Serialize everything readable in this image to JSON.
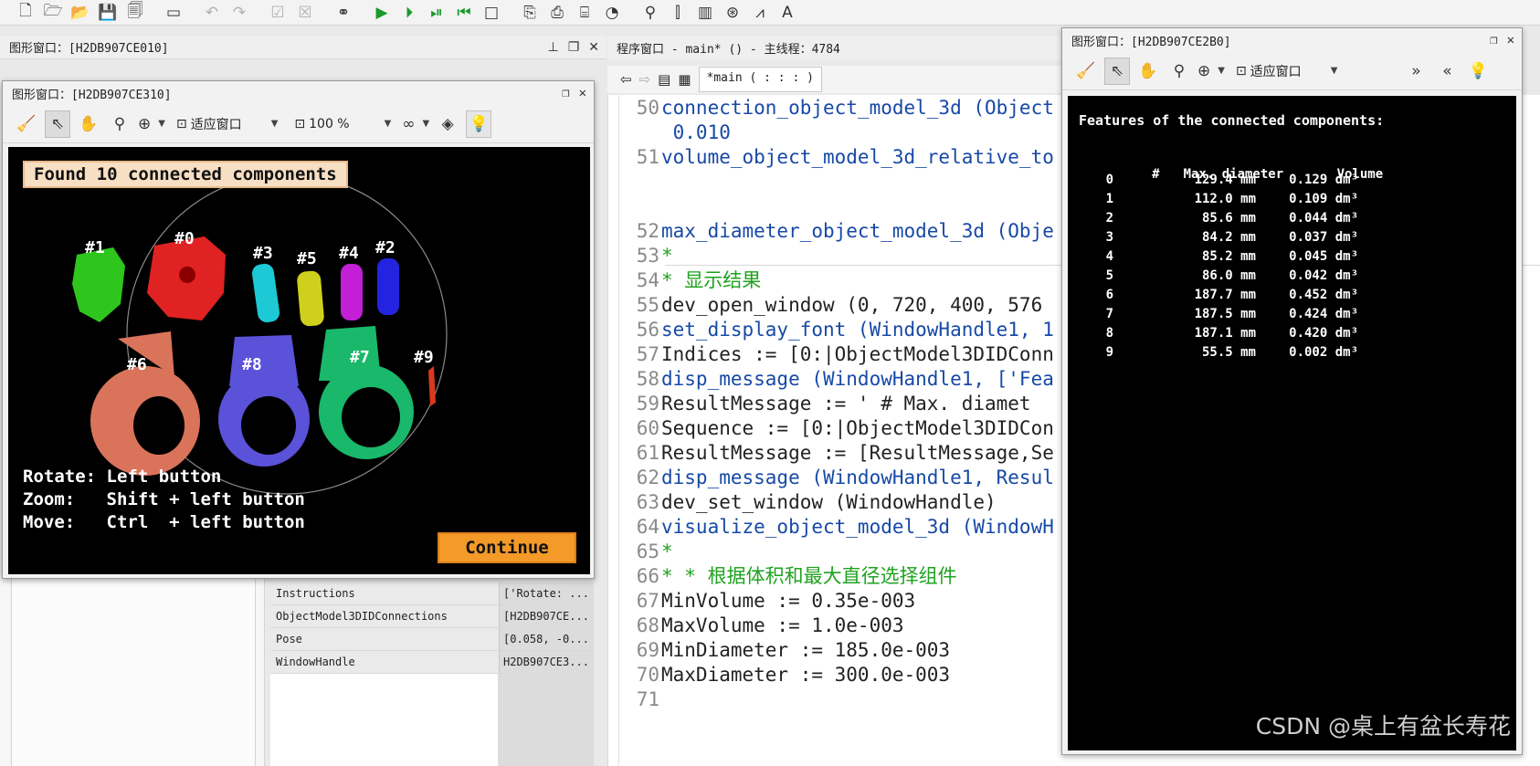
{
  "toolbar": {
    "icons": [
      "new-file-icon",
      "open-file-icon",
      "open-example-icon",
      "save-icon",
      "save-all-icon",
      "record-icon",
      "undo-icon",
      "redo-icon",
      "check-icon",
      "clear-check-icon",
      "find-icon",
      "run-icon",
      "step-over-icon",
      "step-into-icon",
      "step-out-icon",
      "stop-icon",
      "insert-icon",
      "export-icon",
      "assistant-icon",
      "profiler-icon",
      "zoom-icon",
      "histogram-icon",
      "bar-chart-icon",
      "ocr-icon",
      "line-profile-icon",
      "font-icon"
    ]
  },
  "bg_graphics_window": {
    "title": "图形窗口：[H2DB907CE010]"
  },
  "program_window": {
    "title": "程序窗口 - main* () - 主线程：4784",
    "tab_label": "*main ( : : : )",
    "lines": [
      {
        "n": "50",
        "text": "connection_object_model_3d (Object",
        "kind": "op"
      },
      {
        "n": "",
        "text": "                         0.010",
        "kind": "op"
      },
      {
        "n": "51",
        "text": "volume_object_model_3d_relative_to",
        "kind": "op"
      },
      {
        "n": "52",
        "text": "max_diameter_object_model_3d (Obje",
        "kind": "op"
      },
      {
        "n": "53",
        "text": "*",
        "kind": "cm"
      },
      {
        "n": "54",
        "text": "* 显示结果",
        "kind": "cm"
      },
      {
        "n": "55",
        "text": "dev_open_window (0, 720, 400, 576",
        "kind": "as"
      },
      {
        "n": "56",
        "text": "set_display_font (WindowHandle1, 1",
        "kind": "op"
      },
      {
        "n": "57",
        "text": "Indices := [0:|ObjectModel3DIDConn",
        "kind": "as"
      },
      {
        "n": "58",
        "text": "disp_message (WindowHandle1, ['Fea",
        "kind": "op"
      },
      {
        "n": "59",
        "text": "ResultMessage := '  #  Max. diamet",
        "kind": "as"
      },
      {
        "n": "60",
        "text": "Sequence := [0:|ObjectModel3DIDCon",
        "kind": "as"
      },
      {
        "n": "61",
        "text": "ResultMessage := [ResultMessage,Se",
        "kind": "as"
      },
      {
        "n": "62",
        "text": "disp_message (WindowHandle1, Resul",
        "kind": "op"
      },
      {
        "n": "63",
        "text": "dev_set_window (WindowHandle)",
        "kind": "as"
      },
      {
        "n": "64",
        "text": "visualize_object_model_3d (WindowH",
        "kind": "op"
      },
      {
        "n": "65",
        "text": "*",
        "kind": "cm"
      },
      {
        "n": "66",
        "text": "* * 根据体积和最大直径选择组件",
        "kind": "cm"
      },
      {
        "n": "67",
        "text": "MinVolume := 0.35e-003",
        "kind": "as"
      },
      {
        "n": "68",
        "text": "MaxVolume := 1.0e-003",
        "kind": "as"
      },
      {
        "n": "69",
        "text": "MinDiameter := 185.0e-003",
        "kind": "as"
      },
      {
        "n": "70",
        "text": "MaxDiameter := 300.0e-003",
        "kind": "as"
      },
      {
        "n": "71",
        "text": "",
        "kind": "as"
      }
    ]
  },
  "variables": [
    {
      "name": "Instructions",
      "value": "['Rotate: ..."
    },
    {
      "name": "ObjectModel3DIDConnections",
      "value": "[H2DB907CE..."
    },
    {
      "name": "Pose",
      "value": "[0.058, -0..."
    },
    {
      "name": "WindowHandle",
      "value": "H2DB907CE3..."
    }
  ],
  "gw310": {
    "title": "图形窗口：[H2DB907CE310]",
    "fit_label": "适应窗口",
    "zoom_label": "100 %",
    "found_text": "Found 10 connected components",
    "instructions": [
      "Rotate: Left button",
      "Zoom:   Shift + left button",
      "Move:   Ctrl  + left button"
    ],
    "continue_label": "Continue",
    "components": [
      {
        "label": "#0",
        "color": "#e02020"
      },
      {
        "label": "#1",
        "color": "#27c81f"
      },
      {
        "label": "#2",
        "color": "#2020e8"
      },
      {
        "label": "#3",
        "color": "#1ccfd6"
      },
      {
        "label": "#4",
        "color": "#c020d8"
      },
      {
        "label": "#5",
        "color": "#d8d81a"
      },
      {
        "label": "#6",
        "color": "#d9735a"
      },
      {
        "label": "#7",
        "color": "#19b86a"
      },
      {
        "label": "#8",
        "color": "#5a52d8"
      },
      {
        "label": "#9",
        "color": "#d83a1a"
      }
    ]
  },
  "gw2b0": {
    "title": "图形窗口：[H2DB907CE2B0]",
    "fit_label": "适应窗口",
    "heading": "Features of the connected components:",
    "col_index": "#",
    "col_diameter": "Max. diameter",
    "col_volume": "Volume",
    "rows": [
      {
        "i": "0",
        "d": "129.4 mm",
        "v": "0.129 dm³"
      },
      {
        "i": "1",
        "d": "112.0 mm",
        "v": "0.109 dm³"
      },
      {
        "i": "2",
        "d": "85.6 mm",
        "v": "0.044 dm³"
      },
      {
        "i": "3",
        "d": "84.2 mm",
        "v": "0.037 dm³"
      },
      {
        "i": "4",
        "d": "85.2 mm",
        "v": "0.045 dm³"
      },
      {
        "i": "5",
        "d": "86.0 mm",
        "v": "0.042 dm³"
      },
      {
        "i": "6",
        "d": "187.7 mm",
        "v": "0.452 dm³"
      },
      {
        "i": "7",
        "d": "187.5 mm",
        "v": "0.424 dm³"
      },
      {
        "i": "8",
        "d": "187.1 mm",
        "v": "0.420 dm³"
      },
      {
        "i": "9",
        "d": "55.5 mm",
        "v": "0.002 dm³"
      }
    ],
    "watermark": "CSDN @桌上有盆长寿花"
  }
}
